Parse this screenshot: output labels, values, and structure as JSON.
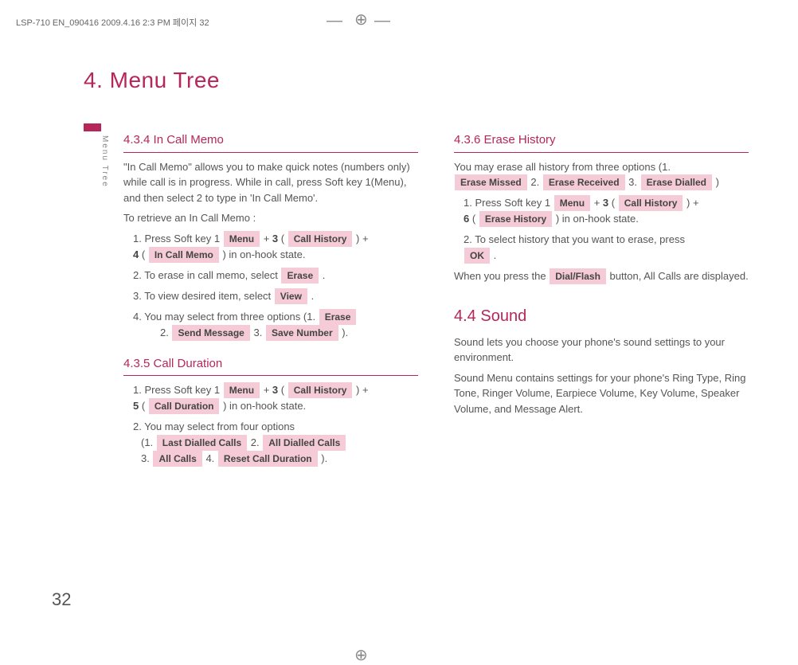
{
  "header_line": "LSP-710 EN_090416  2009.4.16 2:3 PM  페이지 32",
  "chapter_title": "4. Menu Tree",
  "side_label": "Menu Tree",
  "page_number": "32",
  "left": {
    "s434": {
      "heading": "4.3.4 In Call Memo",
      "intro": "\"In Call Memo\" allows you to make quick notes (numbers only) while call is in progress. While in call, press Soft key 1(Menu), and then select 2 to type in 'In Call Memo'.",
      "retrieve": "To retrieve an In Call Memo :",
      "step1_a": "1. Press Soft key 1",
      "step1_menu": "Menu",
      "step1_plus": " + ",
      "step1_3": "3",
      "step1_callhist": "Call History",
      "step1_b": " ) +",
      "step1_4": "4",
      "step1_incallmemo": "In Call Memo",
      "step1_c": " ) in on-hook state.",
      "step2_a": "2. To erase in call memo, select ",
      "step2_erase": "Erase",
      "step3_a": "3. To view desired item, select ",
      "step3_view": "View",
      "step4_a": "4. You may select from three options (1. ",
      "step4_erase": "Erase",
      "step4_b": "2. ",
      "step4_sendmsg": "Send Message",
      "step4_c": "  3. ",
      "step4_savenum": "Save Number",
      "step4_d": " )."
    },
    "s435": {
      "heading": "4.3.5 Call Duration",
      "step1_a": "1. Press Soft key 1",
      "menu": "Menu",
      "plus": " + ",
      "n3": "3",
      "callhist": "Call History",
      "step1_b": " ) +",
      "n5": "5",
      "calldur": "Call Duration",
      "step1_c": ") in on-hook state.",
      "step2_a": "2. You may select from four options",
      "opt1_a": "(1. ",
      "opt1": "Last Dialled Calls",
      "opt2_a": "  2. ",
      "opt2": "All Dialled Calls",
      "opt3_a": "3. ",
      "opt3": "All Calls",
      "opt4_a": "  4. ",
      "opt4": "Reset Call Duration",
      "opt_end": " )."
    }
  },
  "right": {
    "s436": {
      "heading": "4.3.6 Erase History",
      "intro_a": "You may erase all history from three options (1.",
      "opt1": "Erase Missed",
      "intro_b": "  2. ",
      "opt2": "Erase Received",
      "intro_c": "  3. ",
      "opt3": "Erase Dialled",
      "intro_d": " )",
      "step1_a": "1. Press Soft key 1",
      "menu": "Menu",
      "plus": " + ",
      "n3": "3",
      "callhist": "Call History",
      "step1_b": " ) +",
      "n6": "6",
      "erasehist": "Erase History",
      "step1_c": " ) in on-hook state.",
      "step2_a": "2. To select history that you want to erase, press",
      "ok": "OK",
      "outro_a": "When you press the ",
      "dialflash": "Dial/Flash",
      "outro_b": " button, All Calls are displayed."
    },
    "s44": {
      "heading": "4.4 Sound",
      "p1": "Sound lets you choose your phone's sound settings to your environment.",
      "p2": "Sound Menu contains settings for your phone's Ring Type, Ring Tone, Ringer Volume, Earpiece Volume, Key Volume, Speaker Volume, and Message Alert."
    }
  }
}
